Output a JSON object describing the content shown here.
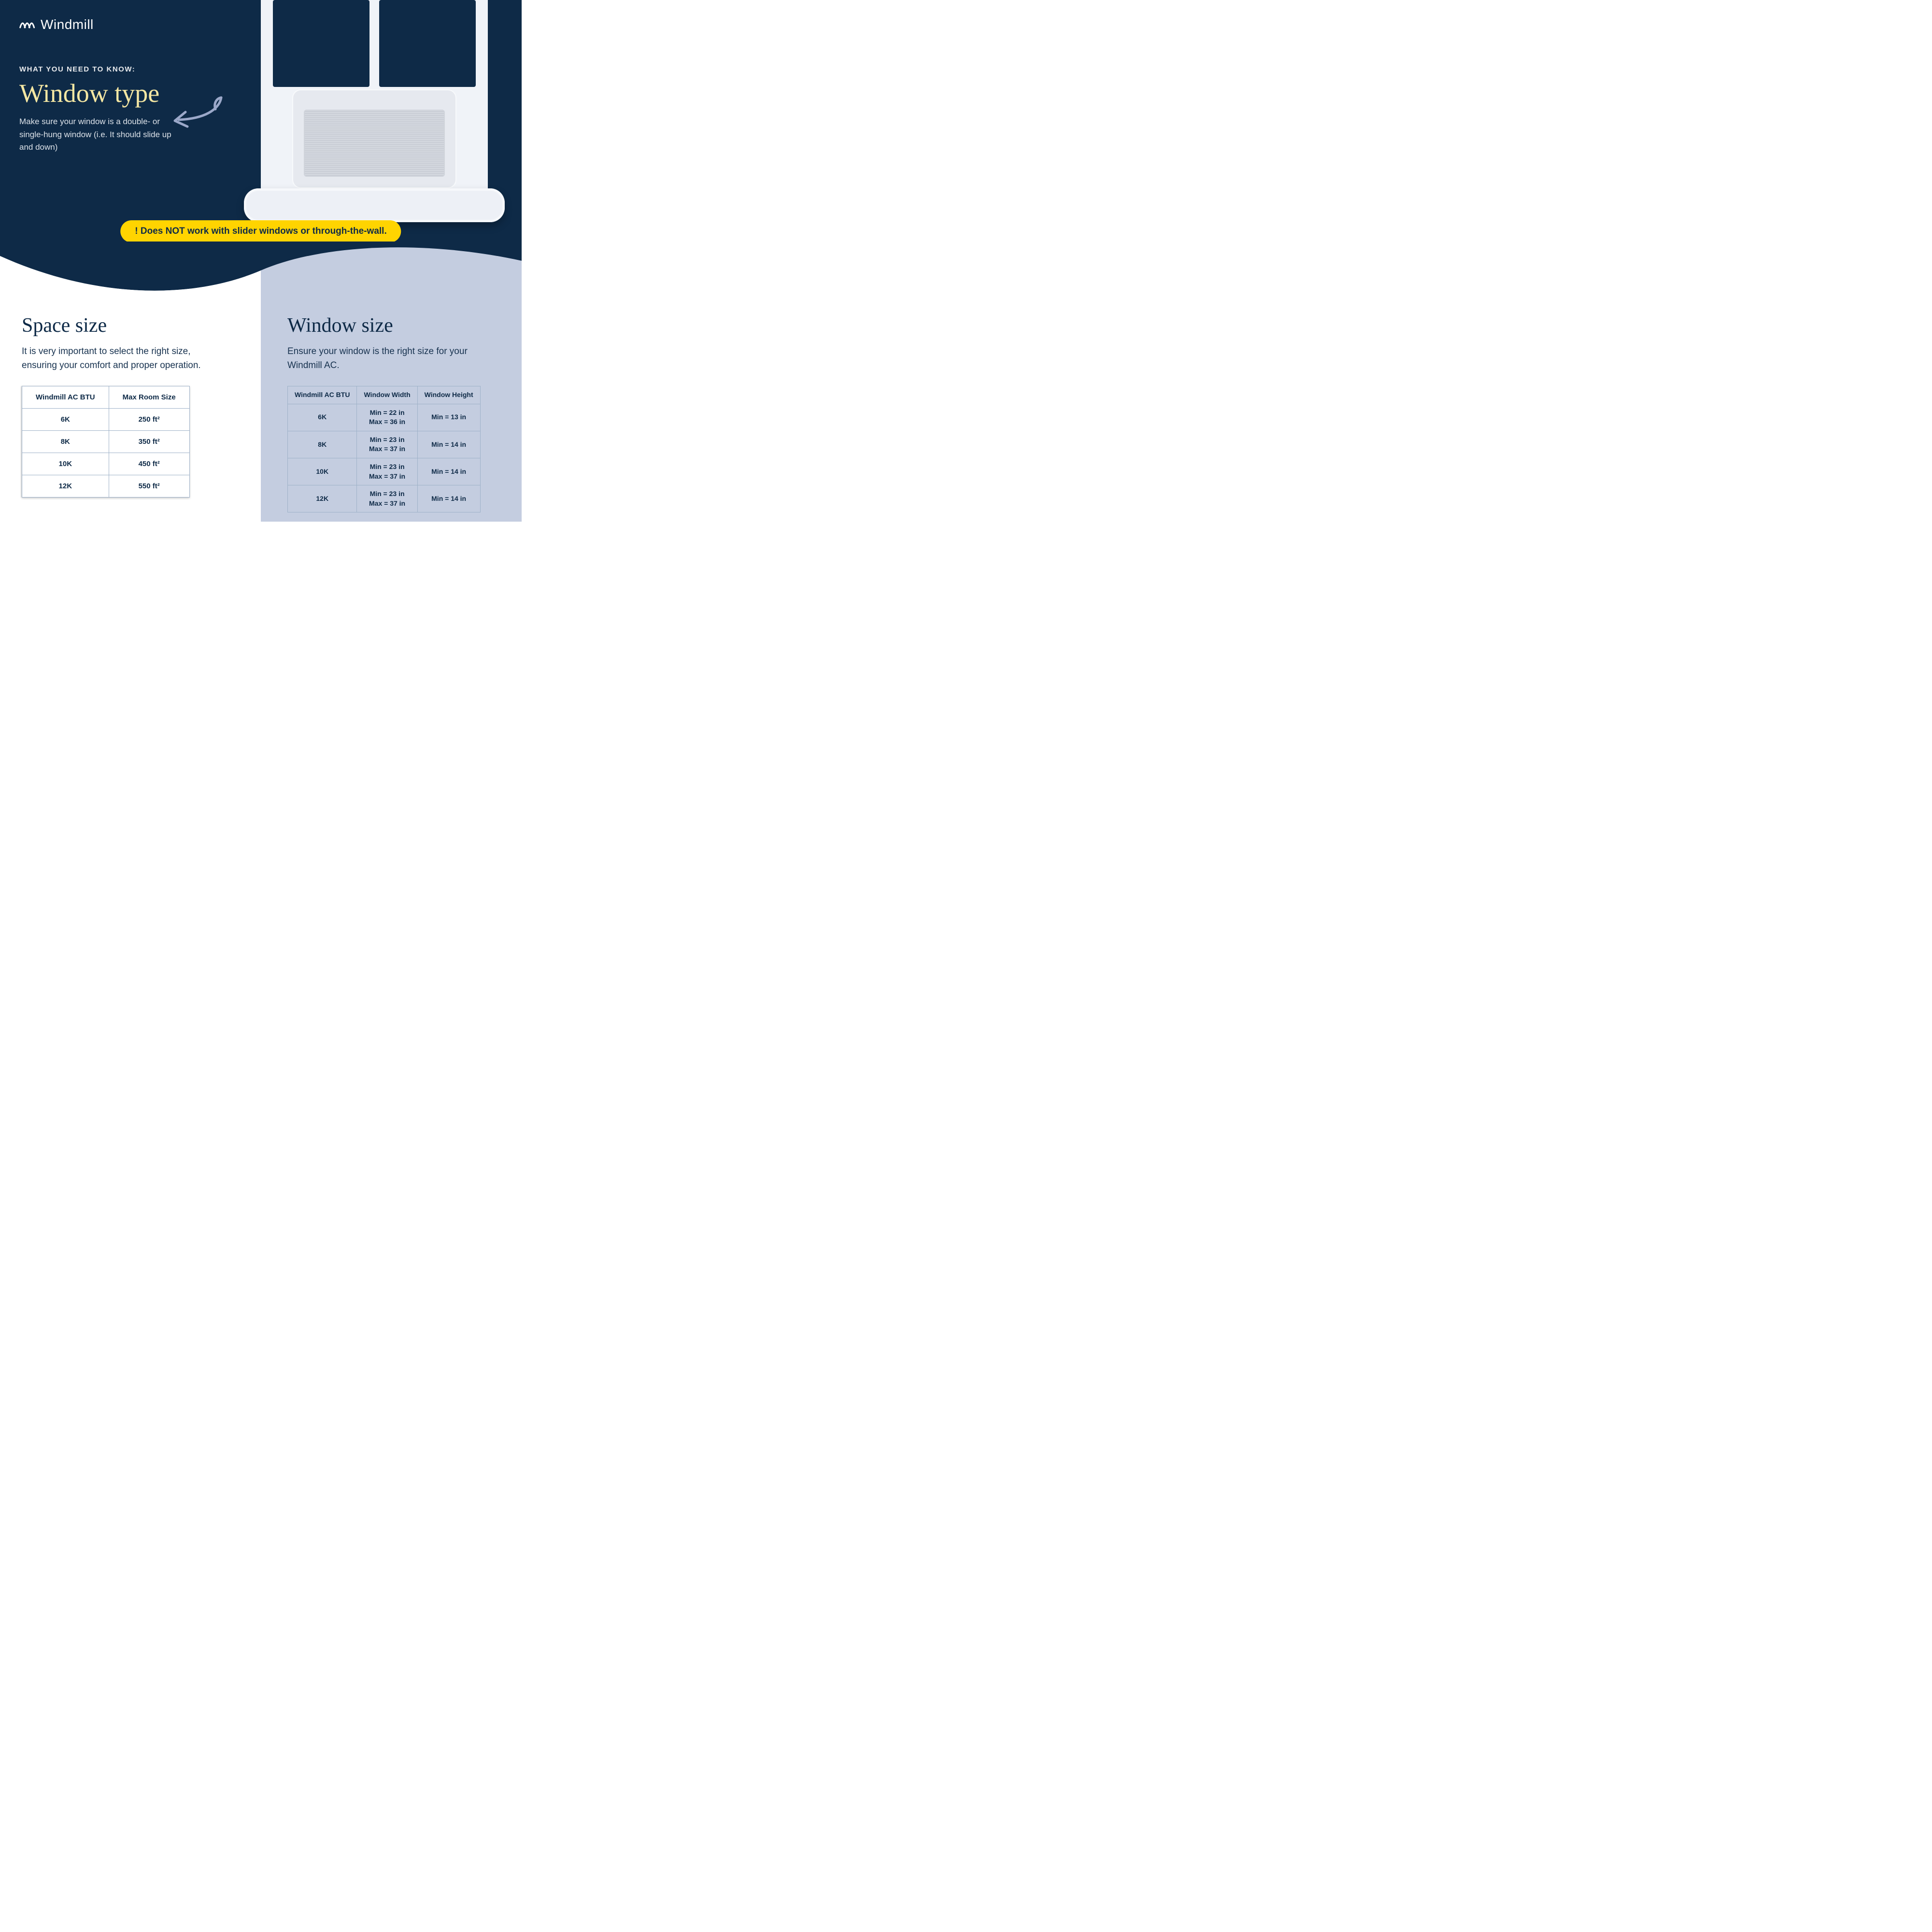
{
  "brand": "Windmill",
  "hero": {
    "eyebrow": "WHAT YOU NEED TO KNOW:",
    "headline": "Window type",
    "desc": "Make sure your window is a double- or single-hung window (i.e. It should slide up and down)",
    "warning": "! Does NOT work with slider windows or through-the-wall."
  },
  "space": {
    "title": "Space size",
    "desc": "It is very important to select the right size, ensuring your comfort and proper operation.",
    "th1": "Windmill AC BTU",
    "th2": "Max Room Size",
    "rows": [
      {
        "btu": "6K",
        "room": "250 ft²"
      },
      {
        "btu": "8K",
        "room": "350 ft²"
      },
      {
        "btu": "10K",
        "room": "450 ft²"
      },
      {
        "btu": "12K",
        "room": "550 ft²"
      }
    ]
  },
  "window": {
    "title": "Window size",
    "desc": "Ensure your window is the right size for your Windmill AC.",
    "th1": "Windmill AC BTU",
    "th2": "Window Width",
    "th3": "Window Height",
    "rows": [
      {
        "btu": "6K",
        "wmin": "Min = 22 in",
        "wmax": "Max = 36 in",
        "h": "Min = 13 in"
      },
      {
        "btu": "8K",
        "wmin": "Min = 23 in",
        "wmax": "Max = 37 in",
        "h": "Min = 14 in"
      },
      {
        "btu": "10K",
        "wmin": "Min = 23 in",
        "wmax": "Max = 37 in",
        "h": "Min = 14 in"
      },
      {
        "btu": "12K",
        "wmin": "Min = 23 in",
        "wmax": "Max = 37 in",
        "h": "Min = 14 in"
      }
    ]
  },
  "chart_data": [
    {
      "type": "table",
      "title": "Space size",
      "columns": [
        "Windmill AC BTU",
        "Max Room Size (ft²)"
      ],
      "rows": [
        [
          "6K",
          250
        ],
        [
          "8K",
          350
        ],
        [
          "10K",
          450
        ],
        [
          "12K",
          550
        ]
      ]
    },
    {
      "type": "table",
      "title": "Window size",
      "columns": [
        "Windmill AC BTU",
        "Window Width Min (in)",
        "Window Width Max (in)",
        "Window Height Min (in)"
      ],
      "rows": [
        [
          "6K",
          22,
          36,
          13
        ],
        [
          "8K",
          23,
          37,
          14
        ],
        [
          "10K",
          23,
          37,
          14
        ],
        [
          "12K",
          23,
          37,
          14
        ]
      ]
    }
  ]
}
